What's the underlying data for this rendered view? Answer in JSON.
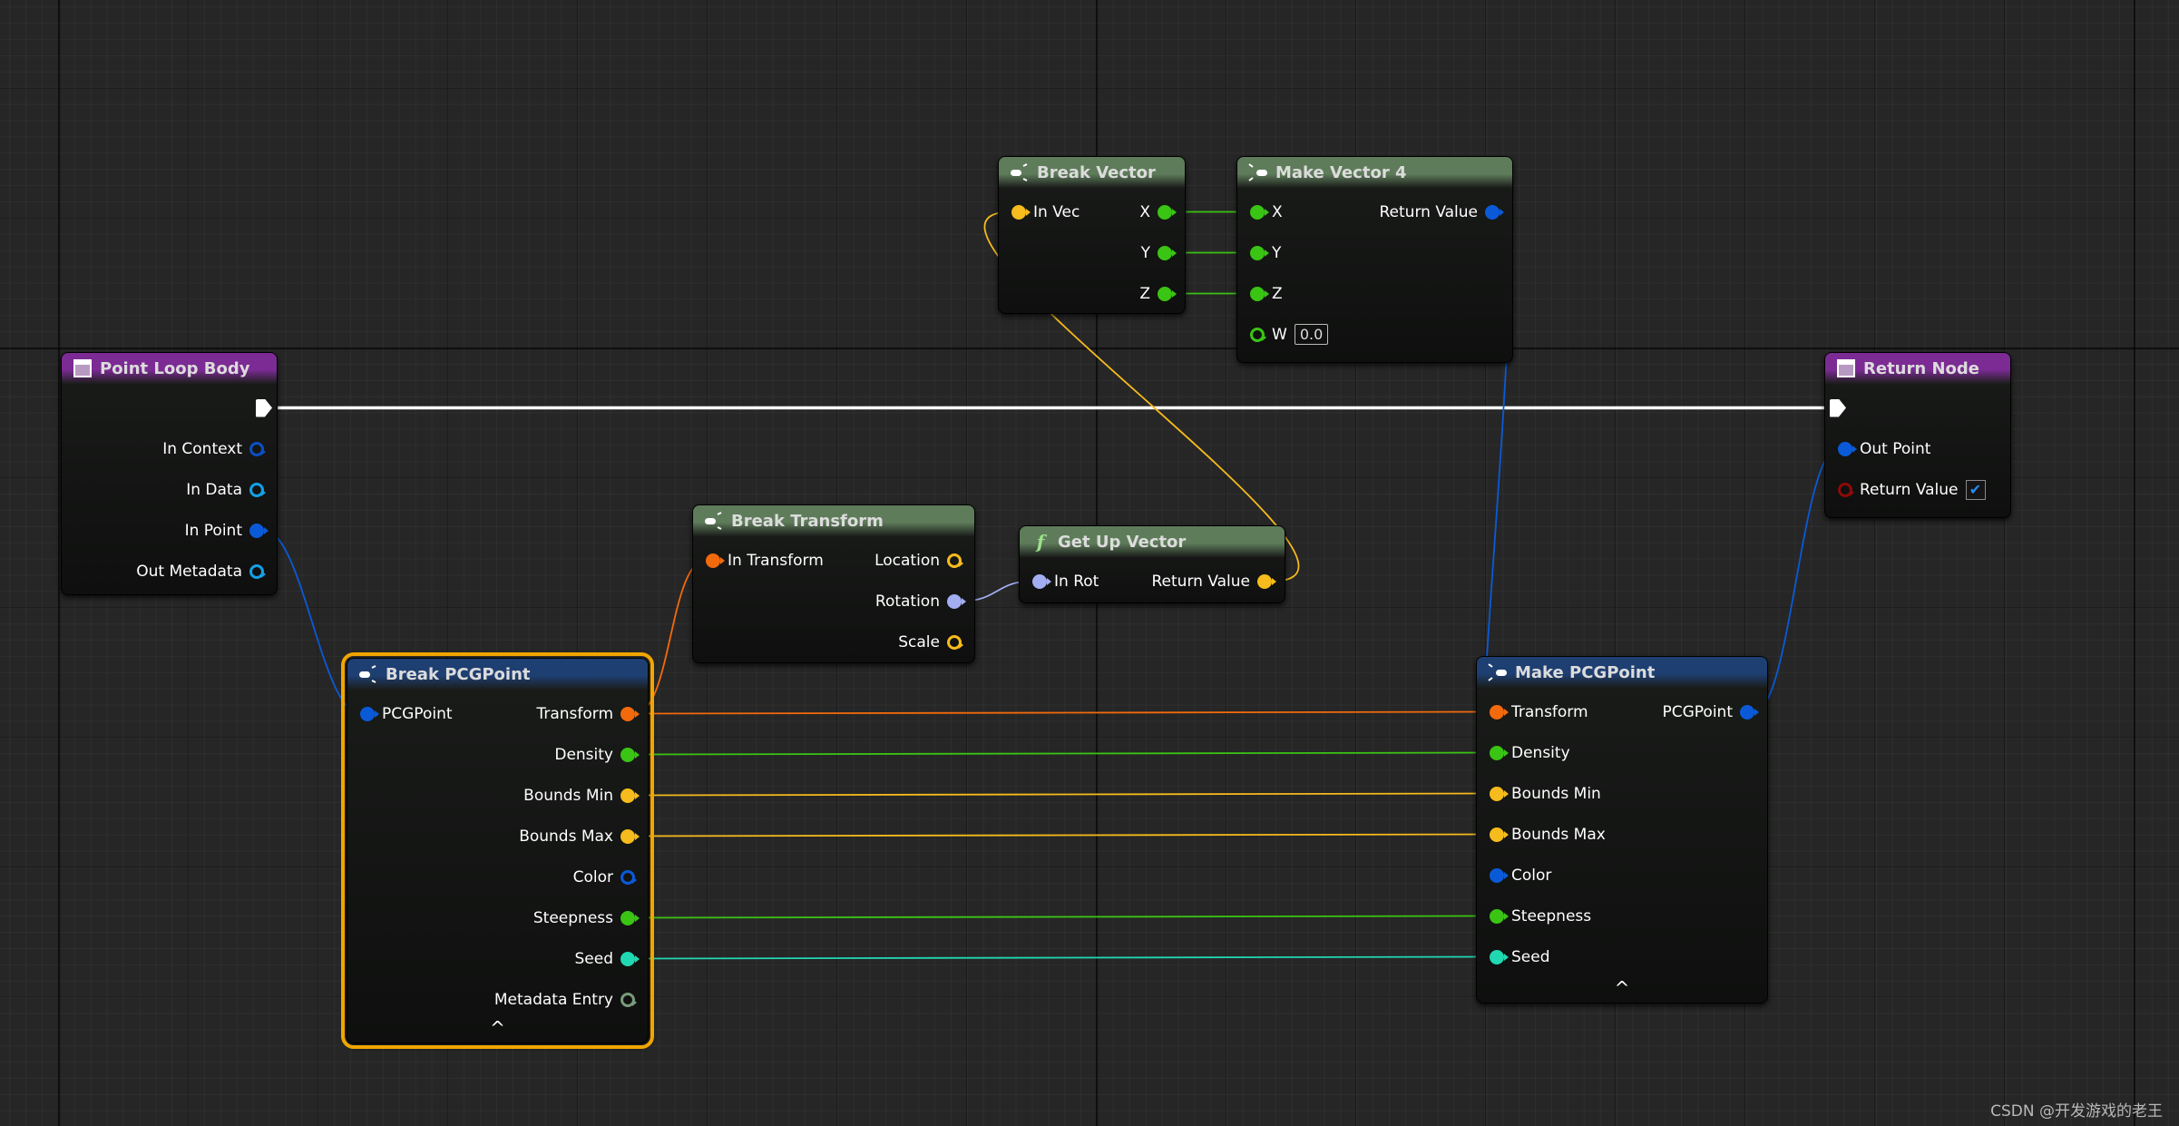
{
  "pin_colors": {
    "exec": "#ffffff",
    "struct": "#0a5ad8",
    "context": "#0a4fc4",
    "data": "#12a0e6",
    "transform": "#f26a0c",
    "float": "#3ac414",
    "vector": "#f6bb1c",
    "rotator": "#a3aef2",
    "int": "#20d8b2",
    "metadata": "#7a9a7a",
    "bool": "#8c0a0a"
  },
  "header_colors": {
    "event": "#7b2b93",
    "struct": "#1e3f72",
    "pure": "#5e7c5a"
  },
  "nodes": [
    {
      "id": "pointLoop",
      "title": "Point Loop Body",
      "kind": "event",
      "icon": "window-icon",
      "rows": [
        {
          "out": {
            "label": "",
            "type": "exec",
            "connected": true
          }
        },
        {
          "out": {
            "label": "In Context",
            "type": "context",
            "connected": false
          }
        },
        {
          "out": {
            "label": "In Data",
            "type": "data",
            "connected": false
          }
        },
        {
          "out": {
            "label": "In Point",
            "type": "struct",
            "connected": true
          }
        },
        {
          "out": {
            "label": "Out Metadata",
            "type": "data",
            "connected": false
          }
        }
      ]
    },
    {
      "id": "breakPCG",
      "title": "Break PCGPoint",
      "kind": "struct",
      "icon": "break-icon",
      "selected": true,
      "collapse": "^",
      "rows": [
        {
          "in": {
            "label": "PCGPoint",
            "type": "struct",
            "connected": true
          },
          "out": {
            "label": "Transform",
            "type": "transform",
            "connected": true
          }
        },
        {
          "out": {
            "label": "Density",
            "type": "float",
            "connected": true
          }
        },
        {
          "out": {
            "label": "Bounds Min",
            "type": "vector",
            "connected": true
          }
        },
        {
          "out": {
            "label": "Bounds Max",
            "type": "vector",
            "connected": true
          }
        },
        {
          "out": {
            "label": "Color",
            "type": "struct",
            "connected": false
          }
        },
        {
          "out": {
            "label": "Steepness",
            "type": "float",
            "connected": true
          }
        },
        {
          "out": {
            "label": "Seed",
            "type": "int",
            "connected": true
          }
        },
        {
          "out": {
            "label": "Metadata Entry",
            "type": "metadata",
            "connected": false
          }
        }
      ]
    },
    {
      "id": "breakTransform",
      "title": "Break Transform",
      "kind": "pure",
      "icon": "break-icon",
      "rows": [
        {
          "in": {
            "label": "In Transform",
            "type": "transform",
            "connected": true
          },
          "out": {
            "label": "Location",
            "type": "vector",
            "connected": false
          }
        },
        {
          "out": {
            "label": "Rotation",
            "type": "rotator",
            "connected": true
          }
        },
        {
          "out": {
            "label": "Scale",
            "type": "vector",
            "connected": false
          }
        }
      ]
    },
    {
      "id": "getUp",
      "title": "Get Up Vector",
      "kind": "pure",
      "icon": "function-icon",
      "rows": [
        {
          "in": {
            "label": "In Rot",
            "type": "rotator",
            "connected": true
          },
          "out": {
            "label": "Return Value",
            "type": "vector",
            "connected": true
          }
        }
      ]
    },
    {
      "id": "breakVector",
      "title": "Break Vector",
      "kind": "pure",
      "icon": "break-icon",
      "rows": [
        {
          "in": {
            "label": "In Vec",
            "type": "vector",
            "connected": true
          },
          "out": {
            "label": "X",
            "type": "float",
            "connected": true
          }
        },
        {
          "out": {
            "label": "Y",
            "type": "float",
            "connected": true
          }
        },
        {
          "out": {
            "label": "Z",
            "type": "float",
            "connected": true
          }
        }
      ]
    },
    {
      "id": "makeVec4",
      "title": "Make Vector 4",
      "kind": "pure",
      "icon": "make-icon",
      "rows": [
        {
          "in": {
            "label": "X",
            "type": "float",
            "connected": true
          },
          "out": {
            "label": "Return Value",
            "type": "struct",
            "connected": true
          }
        },
        {
          "in": {
            "label": "Y",
            "type": "float",
            "connected": true
          }
        },
        {
          "in": {
            "label": "Z",
            "type": "float",
            "connected": true
          }
        },
        {
          "in": {
            "label": "W",
            "type": "float",
            "connected": false,
            "value": "0.0"
          }
        }
      ]
    },
    {
      "id": "returnNode",
      "title": "Return Node",
      "kind": "event",
      "icon": "window-icon",
      "rows": [
        {
          "in": {
            "label": "",
            "type": "exec",
            "connected": true
          }
        },
        {
          "in": {
            "label": "Out Point",
            "type": "struct",
            "connected": true
          }
        },
        {
          "in": {
            "label": "Return Value",
            "type": "bool",
            "connected": false,
            "checked": true
          }
        }
      ]
    },
    {
      "id": "makePCG",
      "title": "Make PCGPoint",
      "kind": "struct",
      "icon": "make-icon",
      "collapse": "^",
      "rows": [
        {
          "in": {
            "label": "Transform",
            "type": "transform",
            "connected": true
          },
          "out": {
            "label": "PCGPoint",
            "type": "struct",
            "connected": true
          }
        },
        {
          "in": {
            "label": "Density",
            "type": "float",
            "connected": true
          }
        },
        {
          "in": {
            "label": "Bounds Min",
            "type": "vector",
            "connected": true
          }
        },
        {
          "in": {
            "label": "Bounds Max",
            "type": "vector",
            "connected": true
          }
        },
        {
          "in": {
            "label": "Color",
            "type": "struct",
            "connected": true
          }
        },
        {
          "in": {
            "label": "Steepness",
            "type": "float",
            "connected": true
          }
        },
        {
          "in": {
            "label": "Seed",
            "type": "int",
            "connected": true
          }
        }
      ]
    }
  ],
  "connections": [
    {
      "from": [
        "pointLoop",
        0
      ],
      "to": [
        "returnNode",
        0
      ],
      "type": "exec"
    },
    {
      "from": [
        "pointLoop",
        3
      ],
      "to": [
        "breakPCG",
        0
      ],
      "type": "struct"
    },
    {
      "from": [
        "breakPCG",
        0
      ],
      "to": [
        "breakTransform",
        0
      ],
      "type": "transform"
    },
    {
      "from": [
        "breakPCG",
        0
      ],
      "to": [
        "makePCG",
        0
      ],
      "type": "transform"
    },
    {
      "from": [
        "breakPCG",
        1
      ],
      "to": [
        "makePCG",
        1
      ],
      "type": "float"
    },
    {
      "from": [
        "breakPCG",
        2
      ],
      "to": [
        "makePCG",
        2
      ],
      "type": "vector"
    },
    {
      "from": [
        "breakPCG",
        3
      ],
      "to": [
        "makePCG",
        3
      ],
      "type": "vector"
    },
    {
      "from": [
        "breakPCG",
        5
      ],
      "to": [
        "makePCG",
        5
      ],
      "type": "float"
    },
    {
      "from": [
        "breakPCG",
        6
      ],
      "to": [
        "makePCG",
        6
      ],
      "type": "int"
    },
    {
      "from": [
        "breakTransform",
        1
      ],
      "to": [
        "getUp",
        0
      ],
      "type": "rotator"
    },
    {
      "from": [
        "getUp",
        0
      ],
      "to": [
        "breakVector",
        0
      ],
      "type": "vector"
    },
    {
      "from": [
        "breakVector",
        0
      ],
      "to": [
        "makeVec4",
        0
      ],
      "type": "float"
    },
    {
      "from": [
        "breakVector",
        1
      ],
      "to": [
        "makeVec4",
        1
      ],
      "type": "float"
    },
    {
      "from": [
        "breakVector",
        2
      ],
      "to": [
        "makeVec4",
        2
      ],
      "type": "float"
    },
    {
      "from": [
        "makeVec4",
        0
      ],
      "to": [
        "makePCG",
        4
      ],
      "type": "struct"
    },
    {
      "from": [
        "makePCG",
        0
      ],
      "to": [
        "returnNode",
        1
      ],
      "type": "struct"
    }
  ],
  "watermark": "CSDN @开发游戏的老王"
}
